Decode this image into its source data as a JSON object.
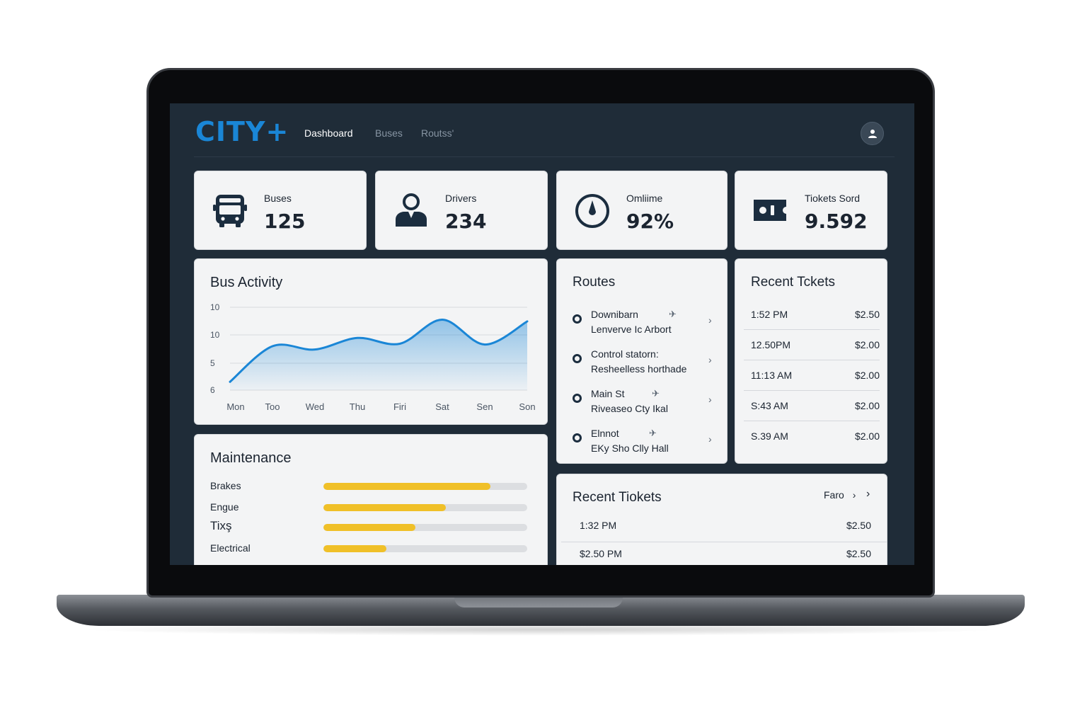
{
  "header": {
    "logo": "CITY+",
    "nav": [
      {
        "label": "Dashboard",
        "active": true
      },
      {
        "label": "Buses",
        "active": false
      },
      {
        "label": "Routss'",
        "active": false
      }
    ],
    "avatar_icon": "user-icon"
  },
  "stats": [
    {
      "label": "Buses",
      "value": "125",
      "icon": "bus-icon"
    },
    {
      "label": "Drivers",
      "value": "234",
      "icon": "driver-icon"
    },
    {
      "label": "Omliime",
      "value": "92%",
      "icon": "gauge-icon"
    },
    {
      "label": "Tiokets Sord",
      "value": "9.592",
      "icon": "ticket-icon"
    }
  ],
  "activity": {
    "title": "Bus Activity",
    "chart_data": {
      "type": "area",
      "title": "Bus Activity",
      "categories": [
        "Mon",
        "Too",
        "Wed",
        "Thu",
        "Firi",
        "Sat",
        "Sen",
        "Son"
      ],
      "y_tick_labels": [
        "10",
        "10",
        "5",
        "6"
      ],
      "values": [
        6,
        10.3,
        9.9,
        11.3,
        10.6,
        13.5,
        10.5,
        13.3
      ],
      "ylim": [
        5,
        15
      ],
      "grid": true,
      "color": "#1a86d6"
    }
  },
  "routes": {
    "title": "Routes",
    "items": [
      {
        "line1": "Downibarn",
        "line2": "Lenverve Ic Arbort",
        "plane": true
      },
      {
        "line1": "Control statorn:",
        "line2": "Resheelless horthade",
        "plane": false
      },
      {
        "line1": "Main St",
        "line2": "Riveaseo Cty Ikal",
        "plane": true
      },
      {
        "line1": "Elnnot",
        "line2": "EKy Sho Clly Hall",
        "plane": true
      }
    ]
  },
  "recent_tickets_side": {
    "title": "Recent Tckets",
    "rows": [
      {
        "time": "1:52 PM",
        "price": "$2.50"
      },
      {
        "time": "12.50PM",
        "price": "$2.00"
      },
      {
        "time": "11:13 AM",
        "price": "$2.00"
      },
      {
        "time": "S:43 AM",
        "price": "$2.00"
      },
      {
        "time": "S.39 AM",
        "price": "$2.00"
      }
    ]
  },
  "maintenance": {
    "title": "Maintenance",
    "items": [
      {
        "label": "Brakes",
        "level": 0.82
      },
      {
        "label": "Engue",
        "level": 0.6
      },
      {
        "label": "Tixş",
        "level": 0.45
      },
      {
        "label": "Electrical",
        "level": 0.31
      }
    ]
  },
  "recent_tickets_bottom": {
    "title": "Recent Tiokets",
    "filter": "Faro",
    "rows": [
      {
        "time": "1:32 PM",
        "price": "$2.50"
      },
      {
        "time": "$2.50 PM",
        "price": "$2.50"
      }
    ]
  }
}
